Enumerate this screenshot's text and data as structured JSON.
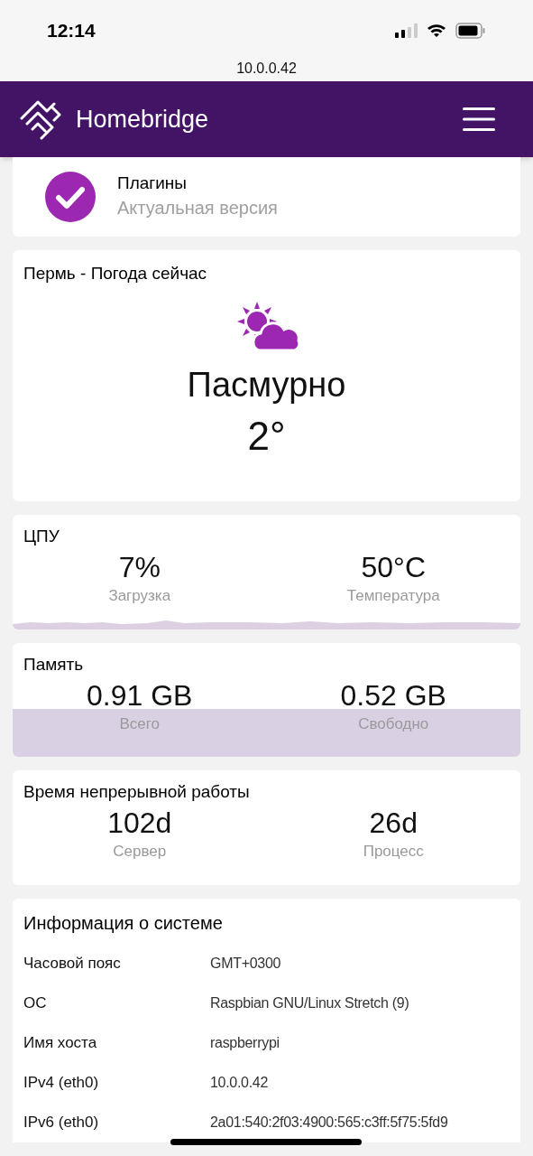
{
  "status_bar": {
    "time": "12:14",
    "url": "10.0.0.42"
  },
  "header": {
    "title": "Homebridge"
  },
  "update_card": {
    "title": "Плагины",
    "subtitle": "Актуальная версия",
    "checked": true
  },
  "weather": {
    "title": "Пермь - Погода сейчас",
    "condition": "Пасмурно",
    "temperature": "2°"
  },
  "cpu": {
    "title": "ЦПУ",
    "stats": [
      {
        "value": "7%",
        "label": "Загрузка"
      },
      {
        "value": "50°C",
        "label": "Температура"
      }
    ]
  },
  "memory": {
    "title": "Память",
    "stats": [
      {
        "value": "0.91 GB",
        "label": "Всего"
      },
      {
        "value": "0.52 GB",
        "label": "Свободно"
      }
    ]
  },
  "uptime": {
    "title": "Время непрерывной работы",
    "stats": [
      {
        "value": "102d",
        "label": "Сервер"
      },
      {
        "value": "26d",
        "label": "Процесс"
      }
    ]
  },
  "system_info": {
    "title": "Информация о системе",
    "rows": [
      {
        "label": "Часовой пояс",
        "value": "GMT+0300"
      },
      {
        "label": "ОС",
        "value": "Raspbian GNU/Linux Stretch (9)"
      },
      {
        "label": "Имя хоста",
        "value": "raspberrypi"
      },
      {
        "label": "IPv4 (eth0)",
        "value": "10.0.0.42"
      },
      {
        "label": "IPv6 (eth0)",
        "value": "2a01:540:2f03:4900:565:c3ff:5f75:5fd9"
      }
    ]
  }
}
